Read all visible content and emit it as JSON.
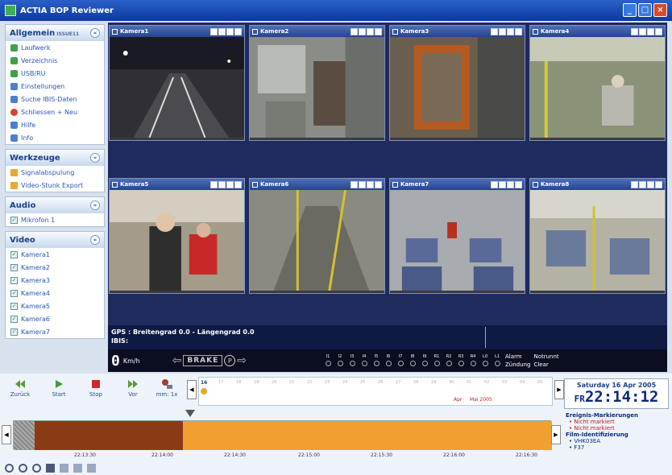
{
  "window": {
    "title": "ACTIA BOP Reviewer"
  },
  "sidebar": {
    "groups": [
      {
        "title": "Allgemein",
        "note": "ISSUE11",
        "items": [
          {
            "label": "Laufwerk",
            "icon": "magnifier-icon"
          },
          {
            "label": "Verzeichnis",
            "icon": "magnifier-icon"
          },
          {
            "label": "USB/RU",
            "icon": "magnifier-icon"
          },
          {
            "label": "Einstellungen",
            "icon": "settings-icon"
          },
          {
            "label": "Suche IBIS-Daten",
            "icon": "search-icon"
          },
          {
            "label": "Schliessen + Neu",
            "icon": "close-icon"
          },
          {
            "label": "Hilfe",
            "icon": "help-icon"
          },
          {
            "label": "Info",
            "icon": "info-icon"
          }
        ]
      },
      {
        "title": "Werkzeuge",
        "items": [
          {
            "label": "Signalabspulung",
            "icon": "folder-icon"
          },
          {
            "label": "Video-Stunk Export",
            "icon": "folder-icon"
          }
        ]
      },
      {
        "title": "Audio",
        "items": [
          {
            "label": "Mikrofon 1",
            "icon": "checkbox-icon"
          }
        ]
      },
      {
        "title": "Video",
        "items": [
          {
            "label": "Kamera1",
            "icon": "checkbox-icon"
          },
          {
            "label": "Kamera2",
            "icon": "checkbox-icon"
          },
          {
            "label": "Kamera3",
            "icon": "checkbox-icon"
          },
          {
            "label": "Kamera4",
            "icon": "checkbox-icon"
          },
          {
            "label": "Kamera5",
            "icon": "checkbox-icon"
          },
          {
            "label": "Kamera6",
            "icon": "checkbox-icon"
          },
          {
            "label": "Kamera7",
            "icon": "checkbox-icon"
          }
        ]
      }
    ]
  },
  "cameras": [
    {
      "label": "Kamera1",
      "scene": "dark road at night with lane markings"
    },
    {
      "label": "Kamera2",
      "scene": "bus interior with driver area"
    },
    {
      "label": "Kamera3",
      "scene": "bus door area with orange frame"
    },
    {
      "label": "Kamera4",
      "scene": "bus interior with seated passengers"
    },
    {
      "label": "Kamera5",
      "scene": "passengers standing near door"
    },
    {
      "label": "Kamera6",
      "scene": "bus floor with yellow poles"
    },
    {
      "label": "Kamera7",
      "scene": "rows of seats with passenger in red"
    },
    {
      "label": "Kamera8",
      "scene": "seats with yellow handrails"
    }
  ],
  "status": {
    "gps": "GPS : Breitengrad 0.0 - Längengrad 0.0",
    "ibis": "IBIS:",
    "speed": "0",
    "speed_unit": "Km/h",
    "brake": "BRAKE",
    "parking": "P",
    "alarm": "Alarm",
    "zundung": "Zündung",
    "notrunnt": "Notrunnt",
    "clear": "Clear"
  },
  "signals": [
    "I1",
    "I2",
    "I3",
    "I4",
    "I5",
    "I6",
    "I7",
    "I8",
    "I9",
    "R1",
    "R2",
    "R3",
    "R4",
    "L0",
    "L1"
  ],
  "toolbar": {
    "buttons": [
      {
        "label": "Zurück",
        "icon": "rewind-icon"
      },
      {
        "label": "Start",
        "icon": "play-icon"
      },
      {
        "label": "Stop",
        "icon": "stop-icon"
      },
      {
        "label": "Vor",
        "icon": "forward-icon"
      },
      {
        "label": "mm: 1x",
        "icon": "speed-icon"
      }
    ]
  },
  "calendar": {
    "labels": [
      "16",
      "17",
      "18",
      "19",
      "20",
      "21",
      "22",
      "23",
      "24",
      "25",
      "26",
      "27",
      "28",
      "29",
      "30",
      "01",
      "02",
      "03",
      "04",
      "05"
    ],
    "apr_label": "Apr",
    "mai_label": "Mai 2005"
  },
  "datetime": {
    "date": "Saturday 16 Apr 2005",
    "prefix": "FR",
    "time": "22:14:12"
  },
  "timeline": {
    "ticks": [
      "22:13:30",
      "22:14:00",
      "22:14:30",
      "22:15:00",
      "22:15:30",
      "22:16:00",
      "22:16:30"
    ]
  },
  "events": {
    "title": "Ereignis-Markierungen",
    "items": [
      "Nicht markiert",
      "Nicht markiert"
    ],
    "film_title": "Film-Identifizierung",
    "film_items": [
      "VHK03EA",
      "F37"
    ]
  },
  "colors": {
    "titlebar": "#0c3aa0",
    "timeline_dark": "#8b3a16",
    "timeline_orange": "#f0a030",
    "panel_bg": "#1e2b5c"
  }
}
